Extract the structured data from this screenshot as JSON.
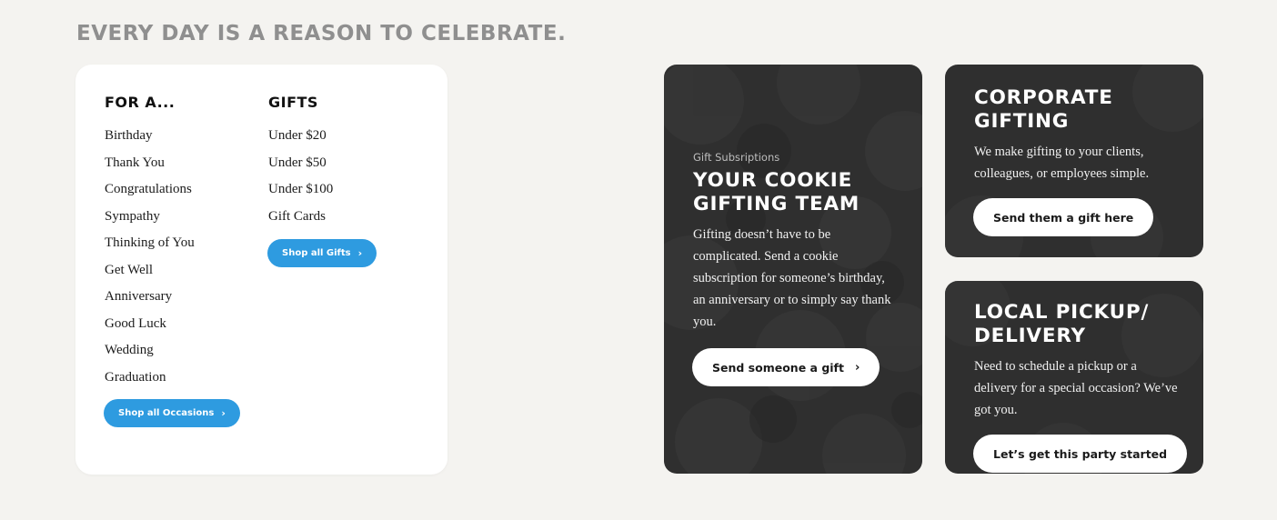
{
  "headline": "EVERY DAY IS A REASON TO CELEBRATE.",
  "menu": {
    "occasions": {
      "title": "FOR A...",
      "items": [
        "Birthday",
        "Thank You",
        "Congratulations",
        "Sympathy",
        "Thinking of You",
        "Get Well",
        "Anniversary",
        "Good Luck",
        "Wedding",
        "Graduation"
      ],
      "button_label": "Shop all Occasions",
      "button_icon": "chevron-right-icon"
    },
    "gifts": {
      "title": "GIFTS",
      "items": [
        "Under $20",
        "Under $50",
        "Under $100",
        "Gift Cards"
      ],
      "button_label": "Shop all Gifts",
      "button_icon": "chevron-right-icon"
    }
  },
  "cards": {
    "subscription": {
      "eyebrow": "Gift Subsriptions",
      "title": "YOUR COOKIE GIFTING TEAM",
      "text": "Gifting doesn’t have to be complicated. Send a cookie subscription for someone’s birthday, an anniversary or to simply say thank you.",
      "button_label": "Send someone a gift",
      "button_icon": "chevron-right-icon"
    },
    "corporate": {
      "title": "CORPORATE GIFTING",
      "text": "We make gifting to your clients, colleagues, or employees simple.",
      "button_label": "Send them a gift here"
    },
    "local": {
      "title": "LOCAL PICKUP/ DELIVERY",
      "text": "Need to schedule a pickup or a delivery for a special occasion? We’ve got you.",
      "button_label": "Let’s get this party started"
    }
  },
  "colors": {
    "background": "#f4f3f0",
    "accent_blue": "#2e9be0",
    "dark_card": "#2f2f2f",
    "headline_gray": "#8f8f8f"
  }
}
